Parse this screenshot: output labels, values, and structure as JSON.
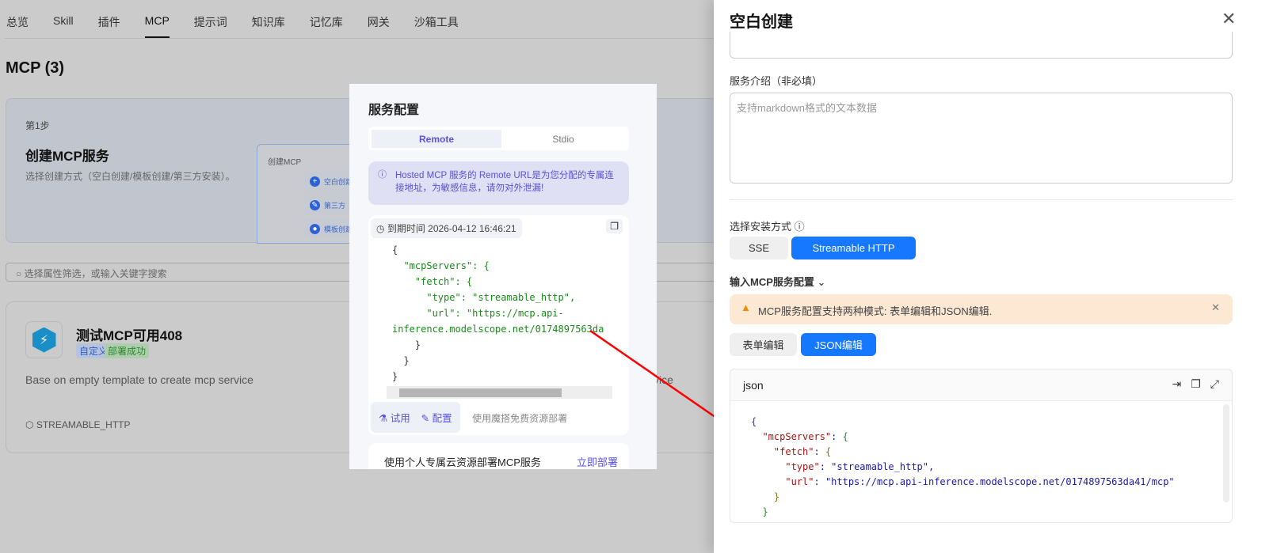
{
  "nav": {
    "tabs": [
      "总览",
      "Skill",
      "插件",
      "MCP",
      "提示词",
      "知识库",
      "记忆库",
      "网关",
      "沙箱工具"
    ],
    "active": "MCP"
  },
  "page_title": "MCP (3)",
  "step": {
    "label": "第1步",
    "title": "创建MCP服务",
    "desc": "选择创建方式（空白创建/模板创建/第三方安装）。",
    "preview": {
      "title": "创建MCP",
      "items": [
        "空白创建",
        "第三方",
        "模板创建"
      ]
    }
  },
  "search": {
    "placeholder": "选择属性筛选，或输入关键字搜索"
  },
  "card": {
    "name": "测试MCP可用408",
    "tags": [
      "自定义",
      "部署成功"
    ],
    "desc": "Base on empty template to create mcp service",
    "protocol": "STREAMABLE_HTTP",
    "desc_tail": "vice"
  },
  "popup": {
    "title": "服务配置",
    "tabs": [
      "Remote",
      "Stdio"
    ],
    "info": "Hosted MCP 服务的 Remote URL是为您分配的专属连接地址，为敏感信息，请勿对外泄漏!",
    "expire": "到期时间 2026-04-12 16:46:21",
    "code": [
      "{",
      "  \"mcpServers\": {",
      "    \"fetch\": {",
      "      \"type\": \"streamable_http\",",
      "      \"url\": \"https://mcp.api-",
      "inference.modelscope.net/0174897563da",
      "    }",
      "  }",
      "}"
    ],
    "actions": [
      "试用",
      "配置",
      "使用魔搭免费资源部署"
    ],
    "bottom": "使用个人专属云资源部署MCP服务",
    "deploy": "立即部署"
  },
  "drawer": {
    "title": "空白创建",
    "intro_label": "服务介绍（非必填）",
    "intro_placeholder": "支持markdown格式的文本数据",
    "install_label": "选择安装方式",
    "install_options": [
      "SSE",
      "Streamable HTTP"
    ],
    "install_selected": "Streamable HTTP",
    "config_label": "输入MCP服务配置",
    "warning": "MCP服务配置支持两种模式: 表单编辑和JSON编辑.",
    "modes": [
      "表单编辑",
      "JSON编辑"
    ],
    "mode_selected": "JSON编辑",
    "editor_lang": "json",
    "json": {
      "k1": "\"mcpServers\"",
      "k2": "\"fetch\"",
      "k3": "\"type\"",
      "v3": "\"streamable_http\"",
      "k4": "\"url\"",
      "v4": "\"https://mcp.api-inference.modelscope.net/0174897563da41/mcp\""
    }
  },
  "colors": {
    "accent": "#1677ff",
    "annotation_arrow": "#ff0000",
    "popup_accent": "#5a52e0"
  }
}
